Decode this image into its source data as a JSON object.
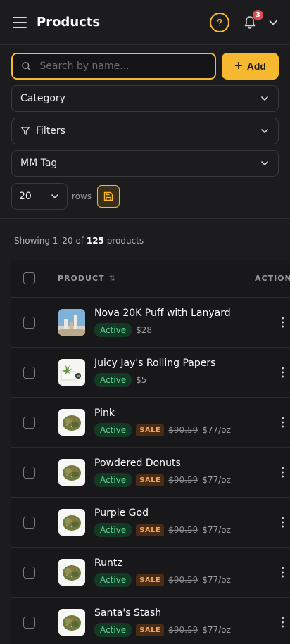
{
  "header": {
    "title": "Products",
    "notification_count": "3"
  },
  "search": {
    "placeholder": "Search by name..."
  },
  "add_button": {
    "label": "Add"
  },
  "filters": {
    "category": "Category",
    "filters": "Filters",
    "mm_tag": "MM Tag"
  },
  "pagination": {
    "rows_value": "20",
    "rows_label": "rows",
    "showing_prefix": "Showing 1–20 of ",
    "total": "125",
    "showing_suffix": " products"
  },
  "table": {
    "col_product": "PRODUCT",
    "col_actions": "ACTIONS",
    "rows": [
      {
        "name": "Nova 20K Puff with Lanyard",
        "status": "Active",
        "sale": "",
        "old_price": "",
        "price": "$28",
        "thumb": "vape-device-image"
      },
      {
        "name": "Juicy Jay's Rolling Papers",
        "status": "Active",
        "sale": "",
        "old_price": "",
        "price": "$5",
        "thumb": "rolling-papers-image"
      },
      {
        "name": "Pink",
        "status": "Active",
        "sale": "SALE",
        "old_price": "$90.59",
        "price": "$77/oz",
        "thumb": "flower-bud-image"
      },
      {
        "name": "Powdered Donuts",
        "status": "Active",
        "sale": "SALE",
        "old_price": "$90.59",
        "price": "$77/oz",
        "thumb": "flower-bud-image"
      },
      {
        "name": "Purple God",
        "status": "Active",
        "sale": "SALE",
        "old_price": "$90.59",
        "price": "$77/oz",
        "thumb": "flower-bud-image"
      },
      {
        "name": "Runtz",
        "status": "Active",
        "sale": "SALE",
        "old_price": "$90.59",
        "price": "$77/oz",
        "thumb": "flower-bud-image"
      },
      {
        "name": "Santa's Stash",
        "status": "Active",
        "sale": "SALE",
        "old_price": "$90.59",
        "price": "$77/oz",
        "thumb": "flower-bud-image"
      }
    ]
  },
  "colors": {
    "accent": "#f5b82e",
    "background": "#1c1c1e",
    "active_badge": "#5fd392",
    "sale_badge": "#f0a35a",
    "notification": "#e5484d"
  }
}
